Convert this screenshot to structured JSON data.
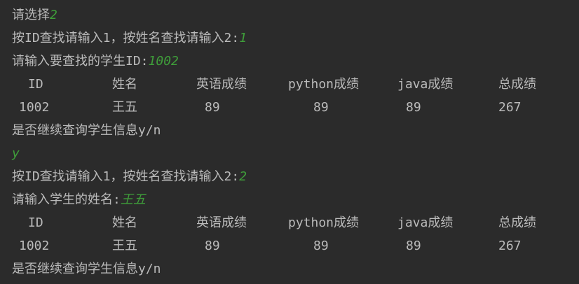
{
  "lines": {
    "l1_prompt": "请选择",
    "l1_input": "2",
    "l2_prompt": "按ID查找请输入1，按姓名查找请输入2:",
    "l2_input": "1",
    "l3_prompt": "请输入要查找的学生ID:",
    "l3_input": "1002",
    "l6_prompt": "是否继续查询学生信息y/n",
    "l7_input": "y",
    "l8_prompt": "按ID查找请输入1，按姓名查找请输入2:",
    "l8_input": "2",
    "l9_prompt": "请输入学生的姓名:",
    "l9_input": "王五",
    "l12_prompt": "是否继续查询学生信息y/n"
  },
  "table1": {
    "headers": [
      "ID",
      "姓名",
      "英语成绩",
      "python成绩",
      "java成绩",
      "总成绩"
    ],
    "row": [
      "1002",
      "王五",
      "89",
      "89",
      "89",
      "267"
    ]
  },
  "table2": {
    "headers": [
      "ID",
      "姓名",
      "英语成绩",
      "python成绩",
      "java成绩",
      "总成绩"
    ],
    "row": [
      "1002",
      "王五",
      "89",
      "89",
      "89",
      "267"
    ]
  },
  "colors": {
    "background": "#2b2b2b",
    "text": "#bbbbbb",
    "user_input": "#3f9e3a"
  }
}
